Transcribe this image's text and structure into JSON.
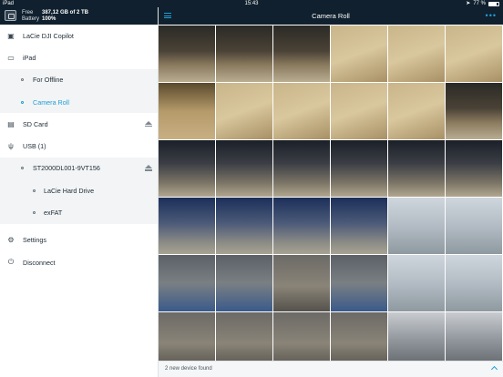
{
  "status_bar": {
    "device": "iPad",
    "time": "15:43",
    "battery_percent_label": "77 %",
    "battery_level": 0.77
  },
  "sidebar": {
    "header": {
      "free_label": "Free",
      "free_value": "387,12 GB of 2 TB",
      "battery_label": "Battery",
      "battery_value": "100%"
    },
    "items": [
      {
        "label": "LaCie DJI Copilot",
        "icon": "copilot-icon",
        "level": 0
      },
      {
        "label": "iPad",
        "icon": "ipad-icon",
        "level": 0
      },
      {
        "label": "For Offline",
        "icon": "bullet-icon",
        "level": 1
      },
      {
        "label": "Camera Roll",
        "icon": "bullet-icon",
        "level": 1,
        "active": true
      },
      {
        "label": "SD Card",
        "icon": "sd-card-icon",
        "level": 0,
        "eject": true
      },
      {
        "label": "USB (1)",
        "icon": "usb-icon",
        "level": 0
      },
      {
        "label": "ST2000DL001-9VT156",
        "icon": "bullet-icon",
        "level": 1,
        "eject": true
      },
      {
        "label": "LaCie Hard Drive",
        "icon": "bullet-icon",
        "level": 2
      },
      {
        "label": "exFAT",
        "icon": "bullet-icon",
        "level": 2
      },
      {
        "label": "Settings",
        "icon": "gear-icon",
        "level": 0
      },
      {
        "label": "Disconnect",
        "icon": "power-icon",
        "level": 0
      }
    ]
  },
  "main": {
    "title": "Camera Roll",
    "bottom_message": "2 new device found",
    "thumbnails": [
      "t-night",
      "t-night",
      "t-night",
      "t-snow",
      "t-snow",
      "t-snow",
      "t-dog",
      "t-snow",
      "t-snow",
      "t-snow",
      "t-snow",
      "t-night",
      "t-street",
      "t-street",
      "t-street",
      "t-street",
      "t-street",
      "t-street",
      "t-blue",
      "t-blue",
      "t-blue",
      "t-blue",
      "t-day",
      "t-day",
      "t-leash",
      "t-leash",
      "t-ground",
      "t-leash",
      "t-day",
      "t-day",
      "t-ground",
      "t-ground",
      "t-ground",
      "t-ground",
      "t-city",
      "t-city"
    ]
  }
}
